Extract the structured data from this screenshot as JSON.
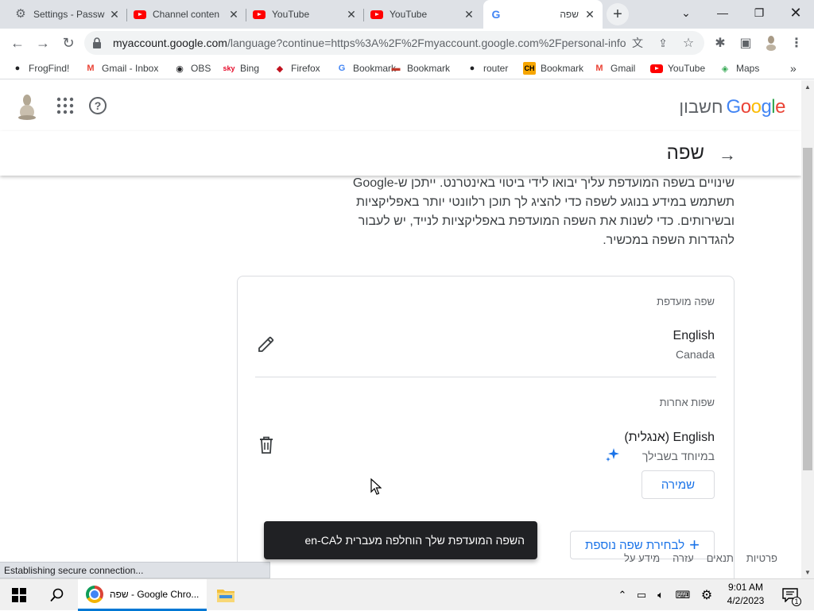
{
  "browser": {
    "tabs": [
      {
        "title": "Settings - Passw",
        "icon": "gear-icon",
        "active": false
      },
      {
        "title": "Channel conten",
        "icon": "youtube-icon",
        "active": false
      },
      {
        "title": "YouTube",
        "icon": "youtube-icon",
        "active": false
      },
      {
        "title": "YouTube",
        "icon": "youtube-icon",
        "active": false
      },
      {
        "title": "שפה",
        "icon": "google-icon",
        "active": true
      }
    ],
    "new_tab_symbol": "+",
    "url": {
      "host": "myaccount.google.com",
      "path": "/language?continue=https%3A%2F%2Fmyaccount.google.com%2Fpersonal-info"
    },
    "bookmarks": [
      {
        "label": "FrogFind!",
        "icon": "globe-icon"
      },
      {
        "label": "Gmail - Inbox",
        "icon": "gmail-icon"
      },
      {
        "label": "OBS",
        "icon": "github-icon"
      },
      {
        "label": "Bing",
        "icon": "sky-icon"
      },
      {
        "label": "Firefox",
        "icon": "firefox-icon"
      },
      {
        "label": "Bookmark",
        "icon": "google-icon"
      },
      {
        "label": "Bookmark",
        "icon": "link-icon"
      },
      {
        "label": "router",
        "icon": "globe-icon"
      },
      {
        "label": "Bookmark",
        "icon": "ch-icon"
      },
      {
        "label": "Gmail",
        "icon": "gmail-icon"
      },
      {
        "label": "YouTube",
        "icon": "youtube-icon"
      },
      {
        "label": "Maps",
        "icon": "maps-icon"
      }
    ],
    "bookmarks_overflow": "»",
    "status_text": "Establishing secure connection..."
  },
  "account_header": {
    "logo_text": "Google",
    "product_text": "חשבון",
    "logo_colors": [
      "#4285f4",
      "#ea4335",
      "#fbbc05",
      "#4285f4",
      "#34a853",
      "#ea4335"
    ]
  },
  "page": {
    "title": "שפה",
    "description": "שינויים בשפה המועדפת עליך יבואו לידי ביטוי באינטרנט. ייתכן ש-Google תשתמש במידע בנוגע לשפה כדי להציג לך תוכן רלוונטי יותר באפליקציות ובשירותים. כדי לשנות את השפה המועדפת באפליקציות לנייד, יש לעבור להגדרות השפה במכשיר.",
    "preferred_section": {
      "heading": "שפה מועדפת",
      "language": "English",
      "region": "Canada"
    },
    "other_section": {
      "heading": "שפות אחרות",
      "language": "English (אנגלית)",
      "recommendation": "במיוחד בשבילך",
      "save_label": "שמירה"
    },
    "add_language_label": "לבחירת שפה נוספת",
    "add_language_symbol": "+",
    "toast": "השפה המועדפת שלך הוחלפה מעברית לen-CA",
    "footer_links": [
      "פרטיות",
      "תנאים",
      "עזרה",
      "מידע על"
    ]
  },
  "taskbar": {
    "chrome_label": "שפה - Google Chro...",
    "time": "9:01 AM",
    "date": "4/2/2023",
    "notification_count": "1"
  },
  "colors": {
    "accent_blue": "#1a73e8",
    "tab_strip": "#dee1e6",
    "toast_bg": "#202124"
  }
}
